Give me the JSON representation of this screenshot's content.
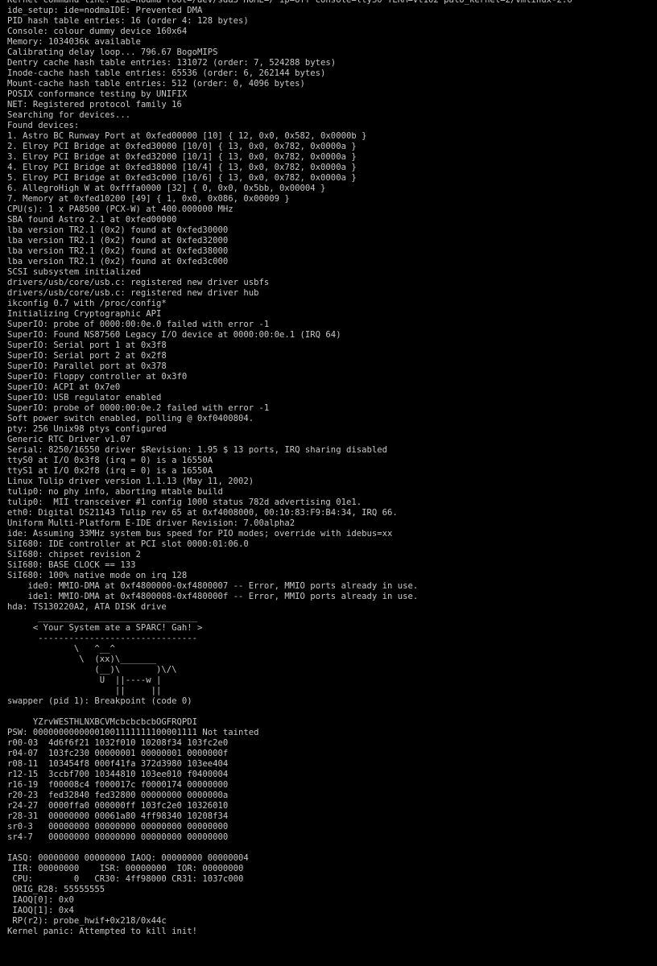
{
  "console": {
    "foreground_color": "#c8c8c8",
    "background_color": "#000000",
    "lines": [
      "Kernel command line: ide=nodma root=/dev/sda3 HOME=/ ip=off console=ttyS0 TERM=vt102 palo_kernel=2/vmlinux-2.6",
      "ide_setup: ide=nodmaIDE: Prevented DMA",
      "PID hash table entries: 16 (order 4: 128 bytes)",
      "Console: colour dummy device 160x64",
      "Memory: 1034036k available",
      "Calibrating delay loop... 796.67 BogoMIPS",
      "Dentry cache hash table entries: 131072 (order: 7, 524288 bytes)",
      "Inode-cache hash table entries: 65536 (order: 6, 262144 bytes)",
      "Mount-cache hash table entries: 512 (order: 0, 4096 bytes)",
      "POSIX conformance testing by UNIFIX",
      "NET: Registered protocol family 16",
      "Searching for devices...",
      "Found devices:",
      "1. Astro BC Runway Port at 0xfed00000 [10] { 12, 0x0, 0x582, 0x0000b }",
      "2. Elroy PCI Bridge at 0xfed30000 [10/0] { 13, 0x0, 0x782, 0x0000a }",
      "3. Elroy PCI Bridge at 0xfed32000 [10/1] { 13, 0x0, 0x782, 0x0000a }",
      "4. Elroy PCI Bridge at 0xfed38000 [10/4] { 13, 0x0, 0x782, 0x0000a }",
      "5. Elroy PCI Bridge at 0xfed3c000 [10/6] { 13, 0x0, 0x782, 0x0000a }",
      "6. AllegroHigh W at 0xfffa0000 [32] { 0, 0x0, 0x5bb, 0x00004 }",
      "7. Memory at 0xfed10200 [49] { 1, 0x0, 0x086, 0x00009 }",
      "CPU(s): 1 x PA8500 (PCX-W) at 400.000000 MHz",
      "SBA found Astro 2.1 at 0xfed00000",
      "lba version TR2.1 (0x2) found at 0xfed30000",
      "lba version TR2.1 (0x2) found at 0xfed32000",
      "lba version TR2.1 (0x2) found at 0xfed38000",
      "lba version TR2.1 (0x2) found at 0xfed3c000",
      "SCSI subsystem initialized",
      "drivers/usb/core/usb.c: registered new driver usbfs",
      "drivers/usb/core/usb.c: registered new driver hub",
      "ikconfig 0.7 with /proc/config*",
      "Initializing Cryptographic API",
      "SuperIO: probe of 0000:00:0e.0 failed with error -1",
      "SuperIO: Found NS87560 Legacy I/O device at 0000:00:0e.1 (IRQ 64)",
      "SuperIO: Serial port 1 at 0x3f8",
      "SuperIO: Serial port 2 at 0x2f8",
      "SuperIO: Parallel port at 0x378",
      "SuperIO: Floppy controller at 0x3f0",
      "SuperIO: ACPI at 0x7e0",
      "SuperIO: USB regulator enabled",
      "SuperIO: probe of 0000:00:0e.2 failed with error -1",
      "Soft power switch enabled, polling @ 0xf0400804.",
      "pty: 256 Unix98 ptys configured",
      "Generic RTC Driver v1.07",
      "Serial: 8250/16550 driver $Revision: 1.95 $ 13 ports, IRQ sharing disabled",
      "ttyS0 at I/O 0x3f8 (irq = 0) is a 16550A",
      "ttyS1 at I/O 0x2f8 (irq = 0) is a 16550A",
      "Linux Tulip driver version 1.1.13 (May 11, 2002)",
      "tulip0: no phy info, aborting mtable build",
      "tulip0:  MII transceiver #1 config 1000 status 782d advertising 01e1.",
      "eth0: Digital DS21143 Tulip rev 65 at 0xf4008000, 00:10:83:F9:B4:34, IRQ 66.",
      "Uniform Multi-Platform E-IDE driver Revision: 7.00alpha2",
      "ide: Assuming 33MHz system bus speed for PIO modes; override with idebus=xx",
      "SiI680: IDE controller at PCI slot 0000:01:06.0",
      "SiI680: chipset revision 2",
      "SiI680: BASE CLOCK == 133",
      "SiI680: 100% native mode on irq 128",
      "    ide0: MMIO-DMA at 0xf4800000-0xf4800007 -- Error, MMIO ports already in use.",
      "    ide1: MMIO-DMA at 0xf4800008-0xf480000f -- Error, MMIO ports already in use.",
      "hda: TS130220A2, ATA DISK drive",
      "      _______________________________",
      "     < Your System ate a SPARC! Gah! >",
      "      -------------------------------",
      "             \\   ^__^",
      "              \\  (xx)\\_______",
      "                 (__)\\       )\\/\\",
      "                  U  ||----w |",
      "                     ||     ||",
      "swapper (pid 1): Breakpoint (code 0)",
      "",
      "     YZrvWESTHLNXBCVMcbcbcbcbOGFRQPDI",
      "PSW: 00000000000001001111111100001111 Not tainted",
      "r00-03  4d6f6f21 1032f010 10208f34 103fc2e0",
      "r04-07  103fc230 00000001 00000001 0000000f",
      "r08-11  103454f8 000f41fa 372d3980 103ee404",
      "r12-15  3ccbf700 10344810 103ee010 f0400004",
      "r16-19  f00008c4 f000017c f0000174 00000000",
      "r20-23  fed32840 fed32800 00000000 0000000a",
      "r24-27  0000ffa0 000000ff 103fc2e0 10326010",
      "r28-31  00000000 00061a80 4ff98340 10208f34",
      "sr0-3   00000000 00000000 00000000 00000000",
      "sr4-7   00000000 00000000 00000000 00000000",
      "",
      "IASQ: 00000000 00000000 IAOQ: 00000000 00000004",
      " IIR: 00000000    ISR: 00000000  IOR: 00000000",
      " CPU:        0   CR30: 4ff98000 CR31: 1037c000",
      " ORIG_R28: 55555555",
      " IAOQ[0]: 0x0",
      " IAOQ[1]: 0x4",
      " RP(r2): probe_hwif+0x218/0x44c",
      "Kernel panic: Attempted to kill init!"
    ]
  }
}
